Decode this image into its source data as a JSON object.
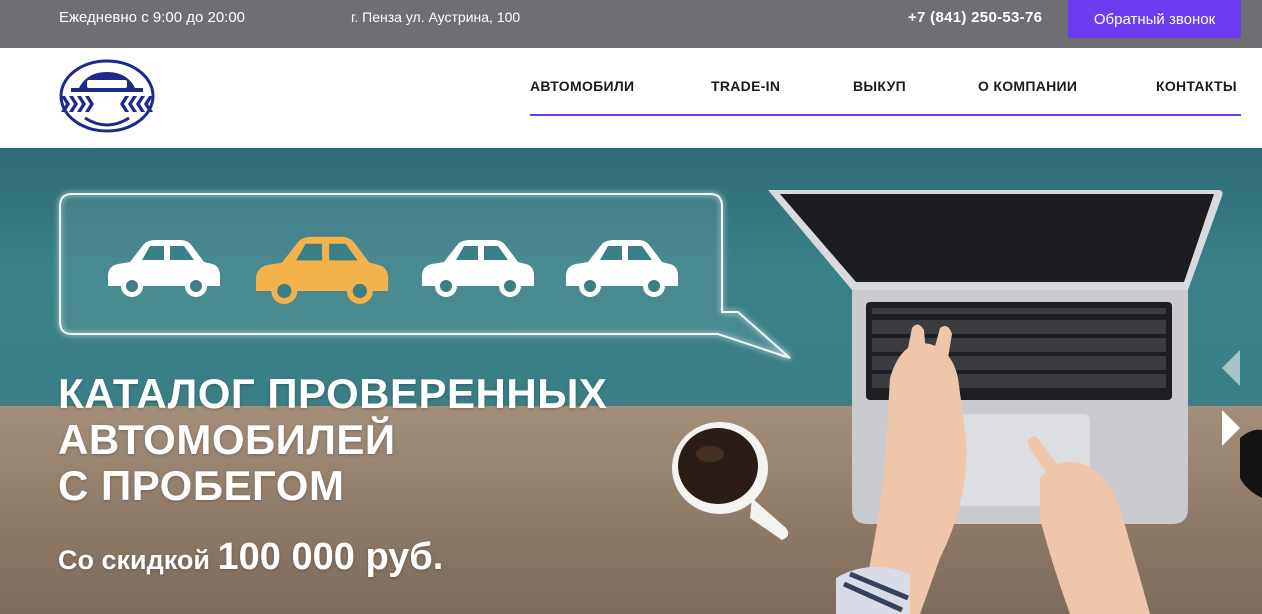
{
  "topbar": {
    "hours": "Ежедневно с 9:00 до 20:00",
    "address": "г. Пенза ул. Аустрина, 100",
    "phone": "+7 (841) 250-53-76",
    "callback_label": "Обратный звонок"
  },
  "nav": {
    "items": [
      {
        "label": "АВТОМОБИЛИ"
      },
      {
        "label": "TRADE-IN"
      },
      {
        "label": "ВЫКУП"
      },
      {
        "label": "О КОМПАНИИ"
      },
      {
        "label": "КОНТАКТЫ"
      }
    ]
  },
  "hero": {
    "title_lines": [
      "КАТАЛОГ ПРОВЕРЕННЫХ",
      "АВТОМОБИЛЕЙ",
      "С ПРОБЕГОМ"
    ],
    "subtitle_prefix": "Со скидкой",
    "subtitle_amount": "100 000 руб."
  },
  "colors": {
    "accent": "#6c3cf0",
    "topbar": "#6f6f73",
    "logo_blue": "#1c2a8c",
    "car_highlight": "#f4b24a"
  },
  "icons": [
    "logo-icon",
    "car-icon",
    "laptop-image",
    "coffee-cup-image",
    "chevron-left-icon",
    "chevron-right-icon"
  ]
}
